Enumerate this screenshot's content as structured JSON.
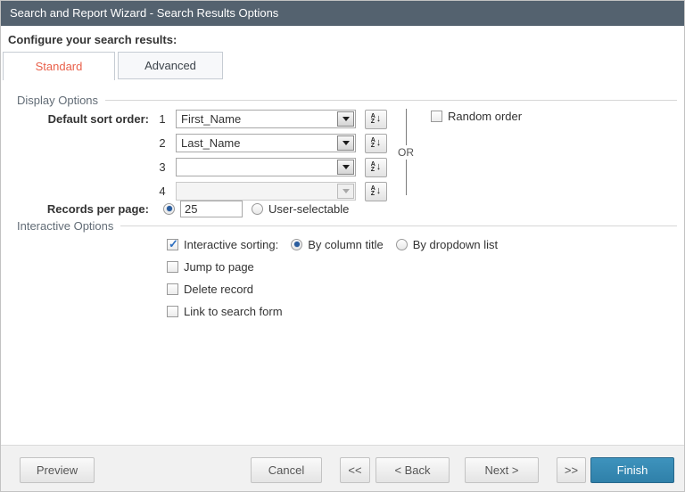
{
  "titlebar": {
    "title": "Search and Report Wizard - Search Results Options"
  },
  "header": {
    "text": "Configure your search results:"
  },
  "tabs": {
    "standard": {
      "label": "Standard",
      "active": true
    },
    "advanced": {
      "label": "Advanced",
      "active": false
    }
  },
  "display": {
    "section_label": "Display Options",
    "sort_label": "Default sort order:",
    "rows": [
      {
        "num": "1",
        "value": "First_Name",
        "disabled": false
      },
      {
        "num": "2",
        "value": "Last_Name",
        "disabled": false
      },
      {
        "num": "3",
        "value": "",
        "disabled": false
      },
      {
        "num": "4",
        "value": "",
        "disabled": true
      }
    ],
    "or_label": "OR",
    "random_label": "Random order",
    "random_checked": false,
    "records_label": "Records per page:",
    "records_value": "25",
    "records_radio_selected": true,
    "user_selectable_label": "User-selectable",
    "user_selectable_selected": false
  },
  "interactive": {
    "section_label": "Interactive Options",
    "sorting_label": "Interactive sorting:",
    "sorting_checked": true,
    "by_column_label": "By column title",
    "by_column_selected": true,
    "by_dropdown_label": "By dropdown list",
    "by_dropdown_selected": false,
    "jump_label": "Jump to page",
    "jump_checked": false,
    "delete_label": "Delete record",
    "delete_checked": false,
    "link_label": "Link to search form",
    "link_checked": false
  },
  "footer": {
    "preview": "Preview",
    "cancel": "Cancel",
    "first": "<<",
    "back": "< Back",
    "next": "Next >",
    "last": ">>",
    "finish": "Finish"
  },
  "icons": {
    "check": "✓",
    "sort_a": "A",
    "sort_z": "Z",
    "sort_down_arrow": "↓"
  },
  "colors": {
    "titlebar_bg": "#54626f",
    "active_tab_text": "#e9604a",
    "finish_button_bg": "#3389b3",
    "check_blue": "#2e6fc0",
    "radio_blue": "#2a5d9f"
  }
}
